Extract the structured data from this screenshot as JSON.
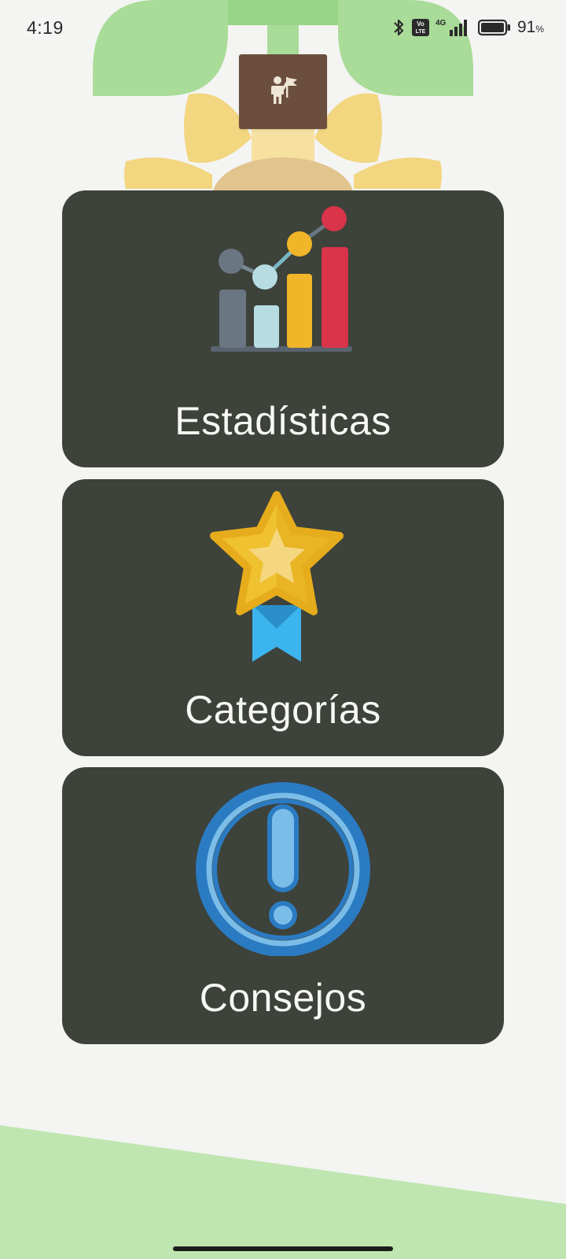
{
  "status_bar": {
    "time": "4:19",
    "network_label": "4G",
    "volte_label": "Vo LTE",
    "battery_percent": "91",
    "battery_symbol": "%"
  },
  "profile": {
    "icon": "person-with-flag-icon",
    "color": "#6b4e3d"
  },
  "menu": {
    "card_color": "#3d423a",
    "items": [
      {
        "label": "Estadísticas",
        "icon": "bar-chart-icon"
      },
      {
        "label": "Categorías",
        "icon": "star-medal-icon"
      },
      {
        "label": "Consejos",
        "icon": "exclamation-circle-icon"
      }
    ]
  },
  "colors": {
    "background": "#f4f4f3",
    "leaf_green": "#a8dc98",
    "petal_yellow": "#f2d680",
    "accent_red": "#d9344a",
    "accent_blue": "#3aa0e6"
  }
}
